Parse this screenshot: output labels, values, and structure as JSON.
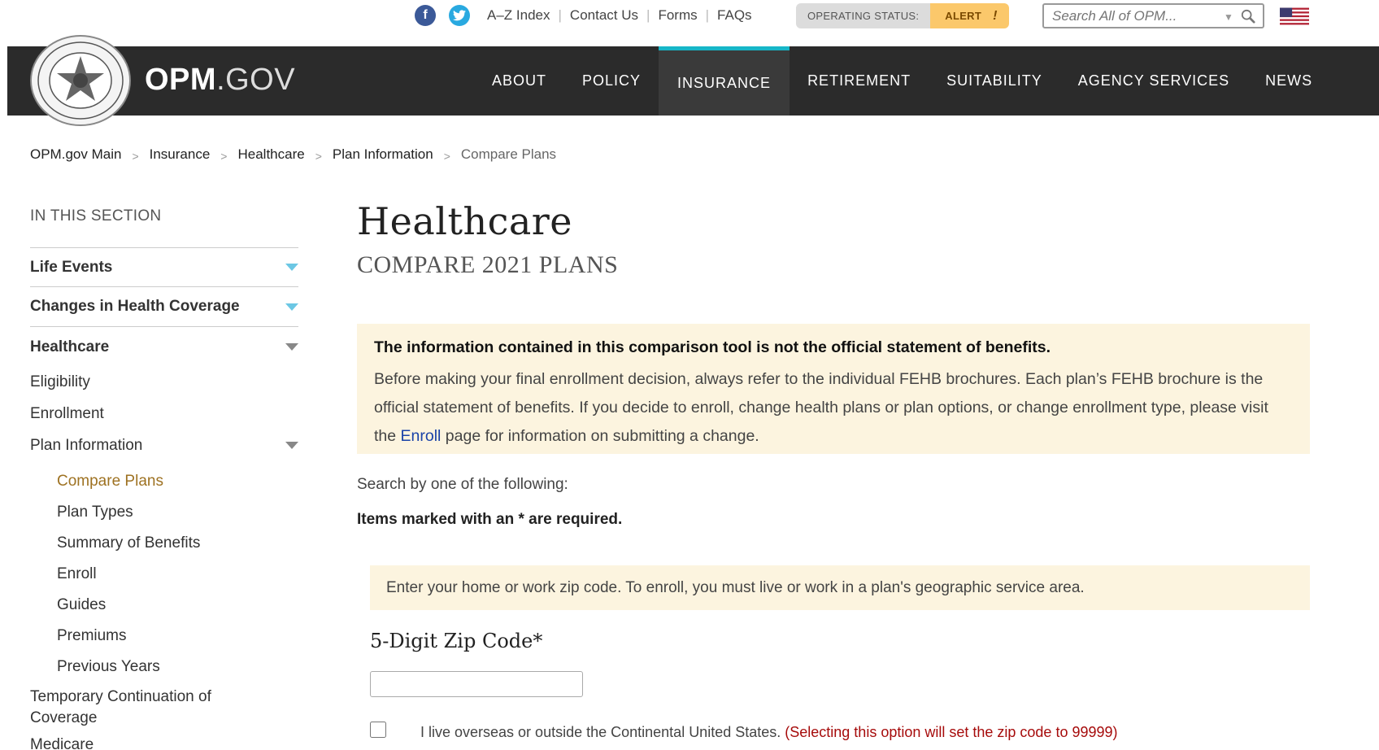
{
  "utility": {
    "links": [
      "A–Z Index",
      "Contact Us",
      "Forms",
      "FAQs"
    ],
    "status_label": "OPERATING STATUS:",
    "status_value": "ALERT",
    "status_icon": "!",
    "search_placeholder": "Search All of OPM...",
    "social": {
      "facebook_glyph": "f",
      "twitter_glyph": "t"
    }
  },
  "brand": {
    "bold": "OPM",
    "rest": ".GOV"
  },
  "nav": {
    "items": [
      "About",
      "Policy",
      "Insurance",
      "Retirement",
      "Suitability",
      "Agency Services",
      "News"
    ],
    "active": "Insurance",
    "accent_color": "#17b6c8"
  },
  "breadcrumb": {
    "items": [
      "OPM.gov Main",
      "Insurance",
      "Healthcare",
      "Plan Information"
    ],
    "current": "Compare Plans",
    "separator": ">"
  },
  "sidebar": {
    "heading": "IN THIS SECTION",
    "life_events": "Life Events",
    "changes": "Changes in Health Coverage",
    "healthcare": "Healthcare",
    "eligibility": "Eligibility",
    "enrollment": "Enrollment",
    "plan_information": "Plan Information",
    "sub_items": [
      "Compare Plans",
      "Plan Types",
      "Summary of Benefits",
      "Enroll",
      "Guides",
      "Premiums",
      "Previous Years"
    ],
    "active_sub": "Compare Plans",
    "temp_continuation": "Temporary Continuation of Coverage",
    "medicare": "Medicare"
  },
  "main": {
    "title": "Healthcare",
    "subtitle": "COMPARE 2021 PLANS",
    "notice": {
      "heading": "The information contained in this comparison tool is not the official statement of benefits.",
      "body_before": "Before making your final enrollment decision, always refer to the individual FEHB brochures. Each plan’s FEHB brochure is the official statement of benefits. If you decide to enroll, change health plans or plan options, or change enrollment type, please visit the ",
      "link": "Enroll",
      "body_after": " page for information on submitting a change."
    },
    "search_intro": "Search by one of the following:",
    "required_note": "Items marked with an * are required.",
    "zip_note": "Enter your home or work zip code. To enroll, you must live or work in a plan's geographic service area.",
    "zip_label": "5-Digit Zip Code*",
    "zip_value": "",
    "overseas_label": "I live overseas or outside the Continental United States.",
    "overseas_warning": "(Selecting this option will set the zip code to 99999)"
  }
}
